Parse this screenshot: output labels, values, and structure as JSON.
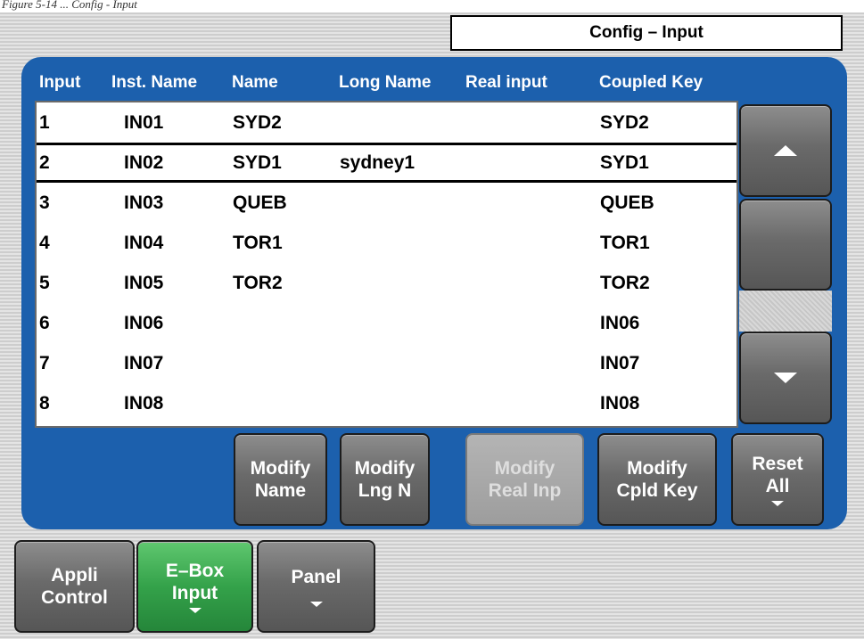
{
  "caption": "Figure 5-14 ... Config - Input",
  "title": "Config – Input",
  "columns": {
    "input": "Input",
    "inst_name": "Inst. Name",
    "name": "Name",
    "long_name": "Long Name",
    "real_input": "Real input",
    "coupled_key": "Coupled Key"
  },
  "rows": [
    {
      "input": "1",
      "inst": "IN01",
      "name": "SYD2",
      "long": "",
      "real": "",
      "coupled": "SYD2"
    },
    {
      "input": "2",
      "inst": "IN02",
      "name": "SYD1",
      "long": "sydney1",
      "real": "",
      "coupled": "SYD1"
    },
    {
      "input": "3",
      "inst": "IN03",
      "name": "QUEB",
      "long": "",
      "real": "",
      "coupled": "QUEB"
    },
    {
      "input": "4",
      "inst": "IN04",
      "name": "TOR1",
      "long": "",
      "real": "",
      "coupled": "TOR1"
    },
    {
      "input": "5",
      "inst": "IN05",
      "name": "TOR2",
      "long": "",
      "real": "",
      "coupled": "TOR2"
    },
    {
      "input": "6",
      "inst": "IN06",
      "name": "",
      "long": "",
      "real": "",
      "coupled": "IN06"
    },
    {
      "input": "7",
      "inst": "IN07",
      "name": "",
      "long": "",
      "real": "",
      "coupled": "IN07"
    },
    {
      "input": "8",
      "inst": "IN08",
      "name": "",
      "long": "",
      "real": "",
      "coupled": "IN08"
    }
  ],
  "selected_row": 2,
  "buttons": {
    "modify_name": [
      "Modify",
      "Name"
    ],
    "modify_lng": [
      "Modify",
      "Lng N"
    ],
    "modify_real": [
      "Modify",
      "Real Inp"
    ],
    "modify_cpld": [
      "Modify",
      "Cpld Key"
    ],
    "reset_all": [
      "Reset",
      "All"
    ]
  },
  "tabs": {
    "appli": [
      "Appli",
      "Control"
    ],
    "ebox": [
      "E–Box",
      "Input"
    ],
    "panel": [
      "Panel"
    ]
  },
  "icons": {
    "scroll_up": "triangle-up-icon",
    "scroll_down": "triangle-down-icon",
    "dropdown": "small-triangle-down-icon"
  },
  "colors": {
    "panel_blue": "#1c60ad",
    "active_tab_green": "#34a24a",
    "button_gray": "#6a6a6a"
  }
}
